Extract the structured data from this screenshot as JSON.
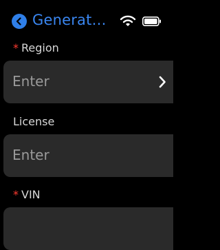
{
  "header": {
    "back_icon": "chevron-left-icon",
    "title": "Generat…",
    "accent": "#2f7fe8"
  },
  "status": {
    "wifi_icon": "wifi-icon",
    "battery_icon": "battery-icon"
  },
  "form": {
    "required_mark": "*",
    "region": {
      "label": "Region",
      "placeholder": "Enter",
      "icon": "chevron-right-icon",
      "required": true
    },
    "license": {
      "label": "License",
      "placeholder": "Enter",
      "required": false
    },
    "vin": {
      "label": "VIN",
      "required": true
    }
  },
  "colors": {
    "background": "#000000",
    "field_bg": "#2a2a2a",
    "required": "#ff3b30",
    "placeholder": "#9a9a9a"
  }
}
